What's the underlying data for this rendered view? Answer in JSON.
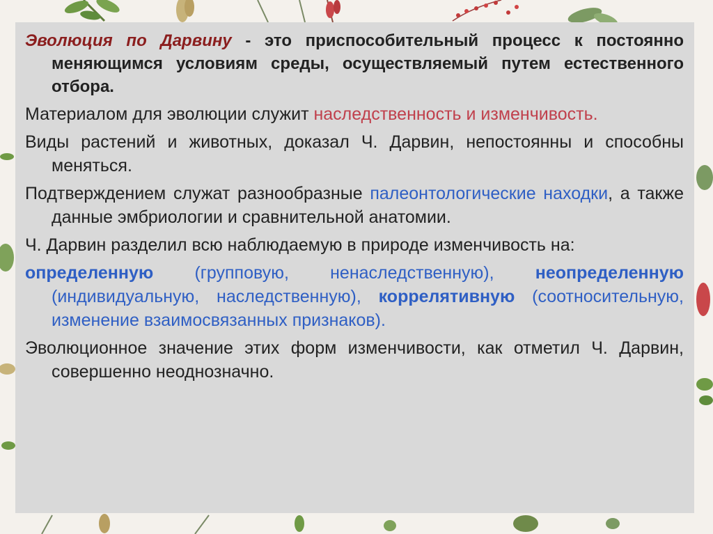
{
  "slide": {
    "paragraphs": [
      {
        "style": "bold",
        "parts": [
          {
            "text": "Эволюция по Дарвину",
            "tone": "red-bold-italic"
          },
          {
            "text": " - это приспособительный процесс к постоянно меняющимся условиям среды, осуществляемый путем естественного отбора.",
            "tone": "plain"
          }
        ]
      },
      {
        "style": "normal",
        "parts": [
          {
            "text": "Материалом для эволюции служит ",
            "tone": "plain"
          },
          {
            "text": "наследственность и изменчивость.",
            "tone": "red"
          }
        ]
      },
      {
        "style": "normal",
        "parts": [
          {
            "text": "Виды растений и животных, доказал Ч. Дарвин, непостоянны и способны меняться.",
            "tone": "plain"
          }
        ]
      },
      {
        "style": "normal",
        "parts": [
          {
            "text": "Подтверждением служат разнообразные ",
            "tone": "plain"
          },
          {
            "text": "палеонтологические находки",
            "tone": "blue"
          },
          {
            "text": ", а также данные эмбриологии и сравнительной анатомии.",
            "tone": "plain"
          }
        ]
      },
      {
        "style": "normal",
        "parts": [
          {
            "text": "Ч. Дарвин разделил всю наблюдаемую в природе изменчивость на:",
            "tone": "plain"
          }
        ]
      },
      {
        "style": "normal",
        "parts": [
          {
            "text": "определенную",
            "tone": "blue-bold"
          },
          {
            "text": " (групповую, ненаследственную), ",
            "tone": "blue"
          },
          {
            "text": "неопределенную",
            "tone": "blue-bold"
          },
          {
            "text": " (индивидуальную, наследственную), ",
            "tone": "blue"
          },
          {
            "text": "коррелятивную",
            "tone": "blue-bold"
          },
          {
            "text": " (соотносительную, изменение взаимосвязанных признаков).",
            "tone": "blue"
          }
        ]
      },
      {
        "style": "normal",
        "parts": [
          {
            "text": "Эволюционное значение этих форм изменчивости, как отметил Ч. Дарвин, совершенно неоднозначно.",
            "tone": "plain"
          }
        ]
      }
    ]
  },
  "colors": {
    "panel": "#d9d9d9",
    "text": "#222222",
    "red": "#c0404c",
    "dark_red": "#8b1e1e",
    "blue": "#2f5fc4",
    "background": "#f4f1ec"
  }
}
